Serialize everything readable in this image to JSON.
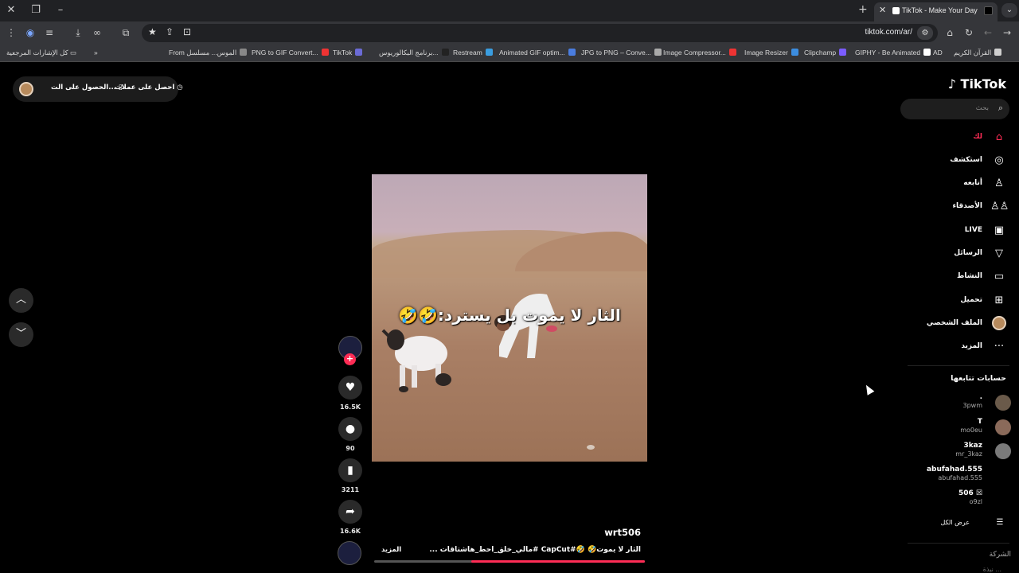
{
  "browser": {
    "tab_title": "TikTok - Make Your Day",
    "url": "tiktok.com/ar/",
    "bookmarks": [
      {
        "label": "القرآن الكريم",
        "color": "#cfcfcf"
      },
      {
        "label": "AD",
        "color": "#444"
      },
      {
        "label": "GIPHY - Be Animated",
        "color": "#fff"
      },
      {
        "label": "Clipchamp",
        "color": "#7b5cff"
      },
      {
        "label": "Image Resizer",
        "color": "#3c8de0"
      },
      {
        "label": "Image Compressor...",
        "color": "#e33"
      },
      {
        "label": "JPG to PNG – Conve...",
        "color": "#aaa"
      },
      {
        "label": "Animated GIF optim...",
        "color": "#4a7de0"
      },
      {
        "label": "Restream",
        "color": "#3a9de0"
      },
      {
        "label": "برنامج البكالوريوس...",
        "color": "#222"
      },
      {
        "label": "TikTok",
        "color": "#6b6bd6"
      },
      {
        "label": "PNG to GIF Convert...",
        "color": "#e33"
      },
      {
        "label": "From الموس... مسلسل",
        "color": "#888"
      }
    ],
    "all_bookmarks": "كل الإشارات المرجعية"
  },
  "get_app": {
    "coins_label": "احصل على عملات",
    "app_label": "الحصول على الت..."
  },
  "video": {
    "caption": "الثار لا يموت بل يسترد:🤣🤣",
    "author": "wrt506",
    "description": "الثار لا يموت🤣 🤣#CapCut #مالي_خلق_احط_هاشتاقات ...",
    "more_label": "المزيد",
    "progress": 0.64,
    "likes": "16.5K",
    "comments": "90",
    "bookmarks": "3211",
    "shares": "16.6K"
  },
  "sidebar": {
    "logo": "TikTok",
    "search_placeholder": "بحث",
    "menu": [
      {
        "label": "لك",
        "icon": "home-icon",
        "glyph": "⌂",
        "active": true
      },
      {
        "label": "استكشف",
        "icon": "compass-icon",
        "glyph": "◎",
        "active": false
      },
      {
        "label": "أتابعه",
        "icon": "following-icon",
        "glyph": "♙",
        "active": false
      },
      {
        "label": "الأصدقاء",
        "icon": "friends-icon",
        "glyph": "♙♙",
        "active": false
      },
      {
        "label": "LIVE",
        "icon": "live-icon",
        "glyph": "▣",
        "active": false
      },
      {
        "label": "الرسائل",
        "icon": "messages-icon",
        "glyph": "▽",
        "active": false
      },
      {
        "label": "النشاط",
        "icon": "activity-icon",
        "glyph": "▭",
        "active": false
      },
      {
        "label": "تحميل",
        "icon": "upload-icon",
        "glyph": "⊞",
        "active": false
      },
      {
        "label": "الملف الشخصي",
        "icon": "profile-avatar",
        "glyph": "",
        "active": false
      },
      {
        "label": "المزيد",
        "icon": "more-icon",
        "glyph": "···",
        "active": false
      }
    ],
    "following_title": "حسابات تتابعها",
    "accounts": [
      {
        "name": ".",
        "handle": "3pwm"
      },
      {
        "name": "T",
        "handle": "mo0eu"
      },
      {
        "name": "3kaz",
        "handle": "mr_3kaz"
      },
      {
        "name": "abufahad.555",
        "handle": "abufahad.555"
      },
      {
        "name": "506 ☒",
        "handle": "o9zl"
      }
    ],
    "see_all": "عرض الكل",
    "company": "الشركة",
    "company_sub": "نبذة ..."
  }
}
